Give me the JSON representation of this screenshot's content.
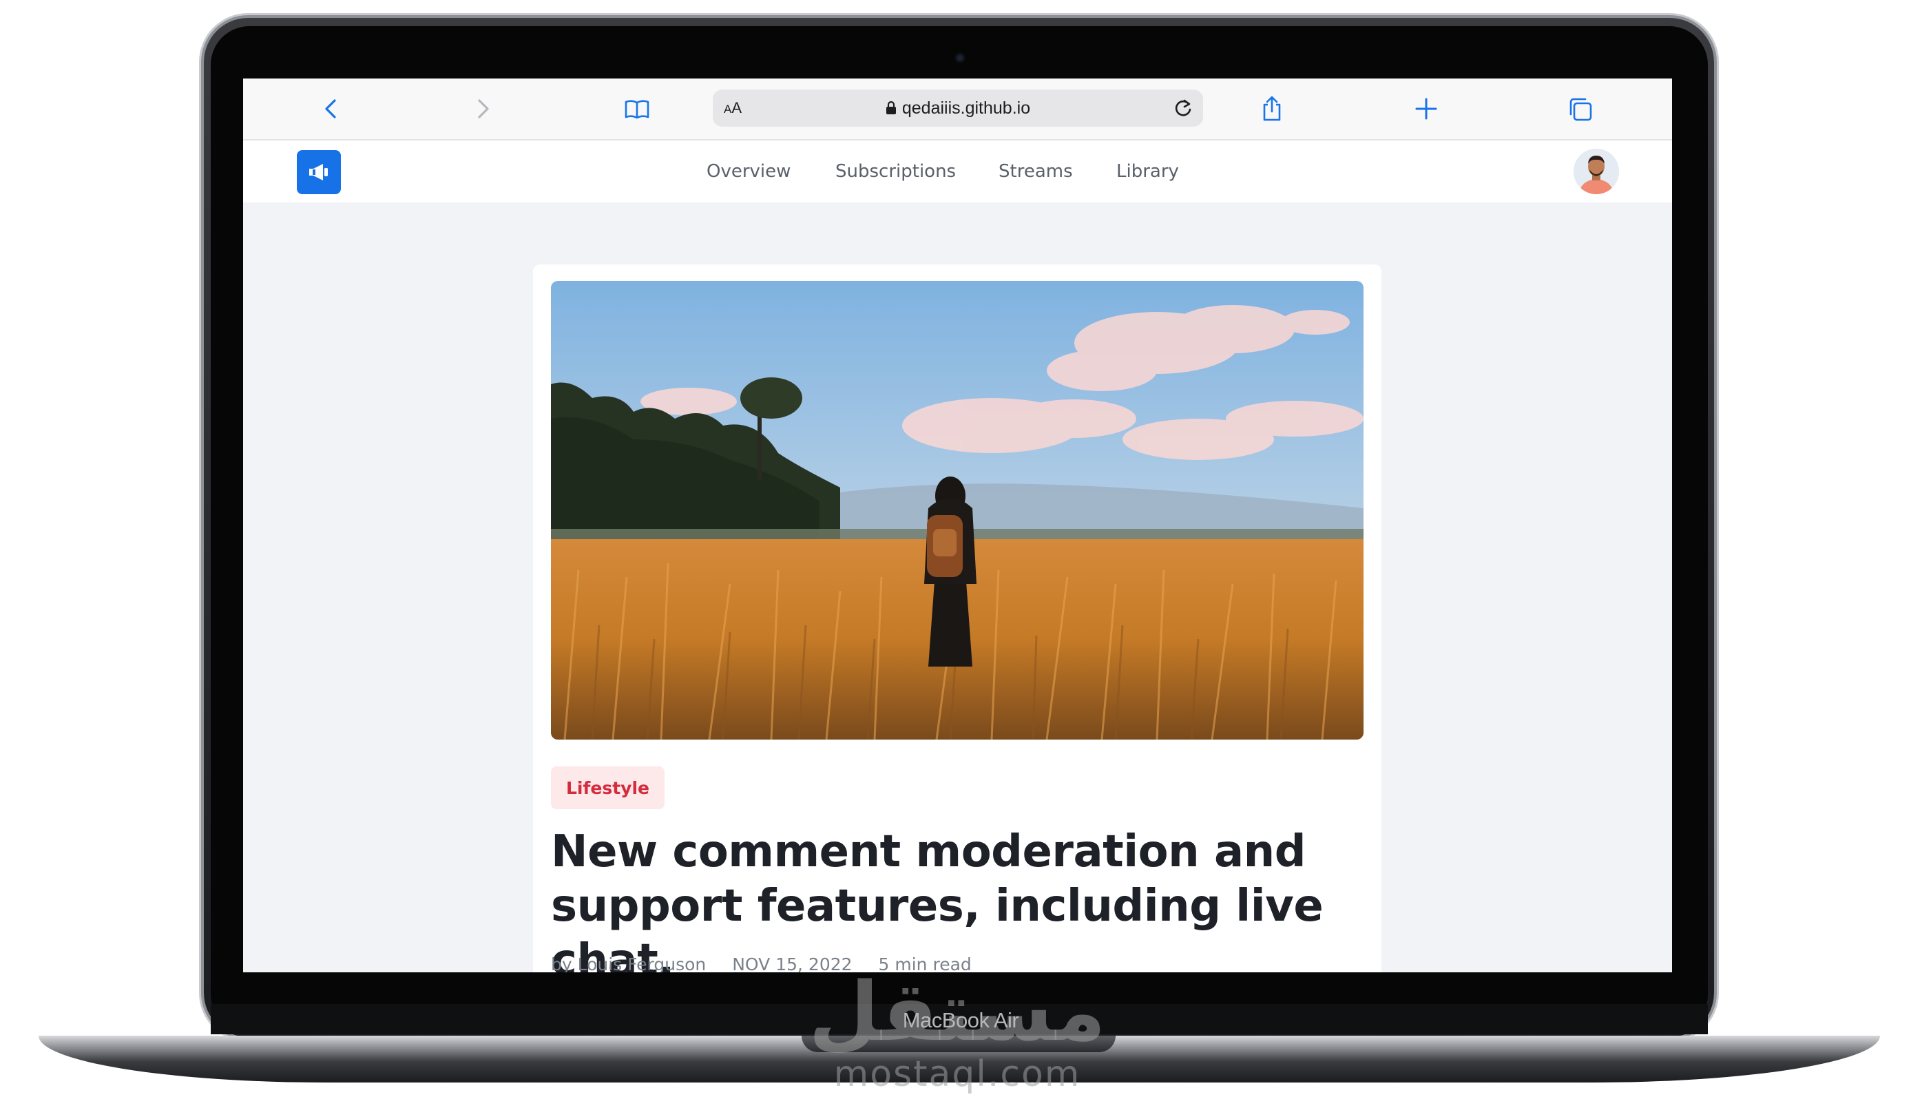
{
  "device": {
    "label": "MacBook Air"
  },
  "watermark": {
    "arabic": "مستقل",
    "latin": "mostaql.com"
  },
  "browser": {
    "text_size_label": "AA",
    "url": "qedaiiis.github.io",
    "icons": [
      "back-icon",
      "forward-icon",
      "bookmarks-icon",
      "lock-icon",
      "reload-icon",
      "share-icon",
      "new-tab-icon",
      "tabs-icon"
    ]
  },
  "nav": {
    "links": [
      "Overview",
      "Subscriptions",
      "Streams",
      "Library"
    ]
  },
  "article": {
    "category": "Lifestyle",
    "title_line1": "New comment moderation and",
    "title_line2": "support features, including live chat.",
    "author": "by Louis Ferguson",
    "date": "NOV 15, 2022",
    "read_time": "5 min read"
  },
  "colors": {
    "accent": "#1672e6",
    "badge_bg": "#fde8ea",
    "badge_text": "#d42c3d",
    "page_bg": "#f1f3f7"
  }
}
